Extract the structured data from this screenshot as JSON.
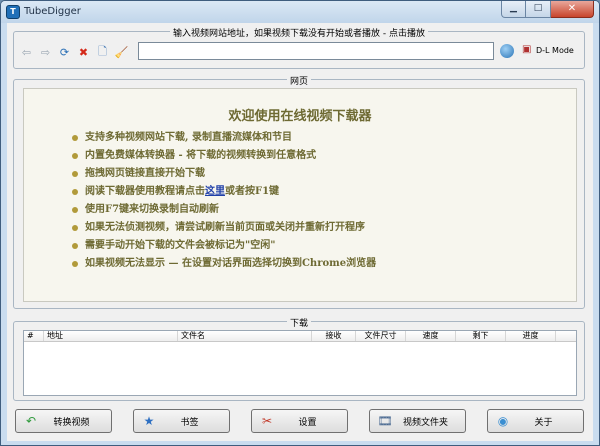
{
  "window": {
    "title": "TubeDigger"
  },
  "url_bar": {
    "group_label": "输入视频网站地址，如果视频下载没有开始或者播放 - 点击播放",
    "value": "",
    "placeholder": "",
    "dl_mode_label": "D-L Mode"
  },
  "web": {
    "group_label": "网页",
    "title": "欢迎使用在线视频下载器",
    "items": [
      "支持多种视频网站下载, 录制直播流媒体和节目",
      "内置免费媒体转换器 - 将下载的视频转换到任意格式",
      "拖拽网页链接直接开始下载",
      "使用F7键来切换录制自动刷新",
      "如果无法侦测视频，请尝试刷新当前页面或关闭并重新打开程序",
      "需要手动开始下载的文件会被标记为\"空闲\"",
      "如果视频无法显示 — 在设置对话界面选择切换到Chrome浏览器"
    ],
    "tutorial": {
      "prefix": "阅读下载器使用教程请点击",
      "link": "这里",
      "suffix": "或者按F1键"
    }
  },
  "downloads": {
    "group_label": "下载",
    "columns": [
      "#",
      "地址",
      "文件名",
      "接收",
      "文件尺寸",
      "速度",
      "剩下",
      "进度"
    ]
  },
  "buttons": {
    "convert": "转换视频",
    "bookmarks": "书签",
    "settings": "设置",
    "video_folder": "视频文件夹",
    "about": "关于"
  },
  "colors": {
    "title_bar": "#c9dcef",
    "web_text": "#6e6a33",
    "web_background": "#f7f6ee",
    "close_button": "#c8452c",
    "link": "#1f3fa8"
  }
}
